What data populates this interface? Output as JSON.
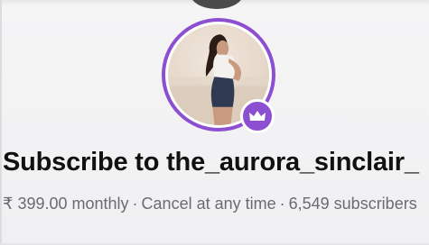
{
  "profile": {
    "avatar_alt": "",
    "badge_icon": "crown-icon",
    "accent_color": "#8d4fd1"
  },
  "subscribe": {
    "title": "Subscribe to the_aurora_sinclair_"
  },
  "meta": {
    "price": "₹ 399.00 monthly",
    "separator": "·",
    "cancel_note": "Cancel at any time",
    "subscribers": "6,549 subscribers"
  }
}
